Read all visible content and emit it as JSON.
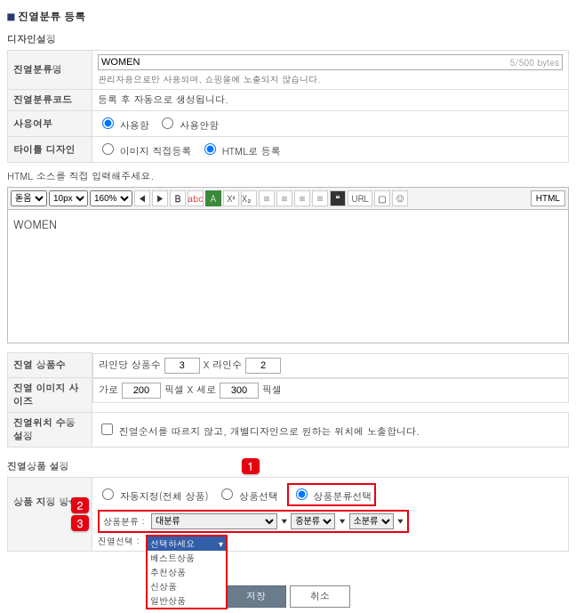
{
  "page_title": "진열분류 등록",
  "design_section_title": "디자인설정",
  "display_section_title": "진열상품 설정",
  "rows": {
    "name_label": "진열분류명",
    "name_value": "WOMEN",
    "name_bytes": "5/500 bytes",
    "name_hint": "관리자용으로만 사용되며, 쇼핑몰에 노출되지 않습니다.",
    "code_label": "진열분류코드",
    "code_hint": "등록 후 자동으로 생성됩니다.",
    "use_label": "사용여부",
    "use_yes": "사용함",
    "use_no": "사용안함",
    "title_design_label": "타이틀 디자인",
    "title_design_img": "이미지 직접등록",
    "title_design_html": "HTML로 등록",
    "html_note": "HTML 소스를 직접 입력해주세요.",
    "editor_font_family": "돋움",
    "editor_font_size": "10px",
    "editor_zoom": "160%",
    "editor_content": "WOMEN",
    "count_label": "진열 상품수",
    "count_prefix": "라인당 상품수",
    "count_per_line": "3",
    "count_mid": "X 라인수",
    "count_lines": "2",
    "size_label": "진열 이미지 사이즈",
    "size_w_label": "가로",
    "size_w": "200",
    "size_px1": "픽셀 X 세로",
    "size_h": "300",
    "size_px2": "픽셀",
    "manual_label": "진열위치 수동 설정",
    "manual_text": "진열순서를 따르지 않고, 개별디자인으로 원하는 위치에 노출합니다.",
    "method_label": "상품 지정 방식",
    "method_auto": "자동지정(전체 상품)",
    "method_select": "상품선택",
    "method_category": "상품분류선택",
    "cat_row_label": "상품분류 :",
    "cat_main": "대분류",
    "cat_mid": "중분류",
    "cat_sub": "소분류",
    "disp_row_label": "진열선택 :",
    "disp_placeholder": "선택하세요",
    "disp_options": [
      "선택하세요",
      "베스트상품",
      "추천상품",
      "신상품",
      "일반상품"
    ],
    "html_btn": "HTML"
  },
  "badges": {
    "b1": "1",
    "b2": "2",
    "b3": "3"
  },
  "buttons": {
    "save": "저장",
    "cancel": "취소"
  },
  "toolbar_icons": {
    "bold": "B",
    "abc": "abc",
    "a_green": "A",
    "x2": "X²",
    "x_sub": "X₂",
    "align1": "≡",
    "align2": "≡",
    "align3": "≡",
    "align4": "≡",
    "quote": "❝",
    "url": "URL",
    "img": "▢",
    "smile": "☺"
  }
}
